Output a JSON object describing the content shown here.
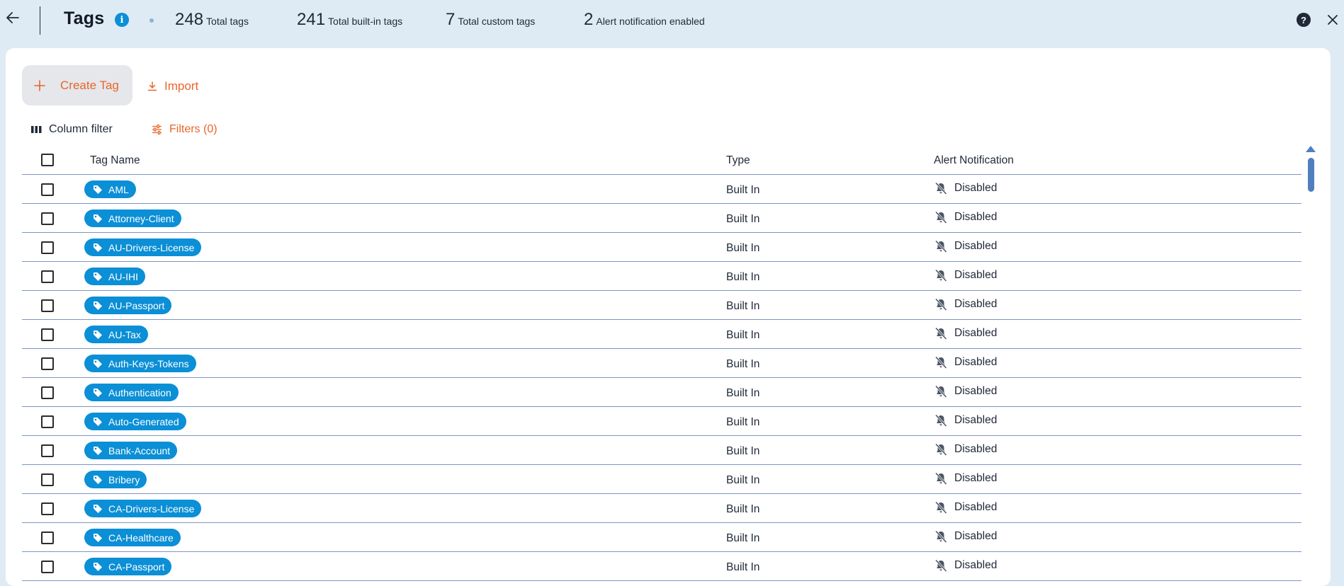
{
  "header": {
    "title": "Tags",
    "stats": [
      {
        "value": "248",
        "label": "Total tags"
      },
      {
        "value": "241",
        "label": "Total built-in tags"
      },
      {
        "value": "7",
        "label": "Total custom tags"
      },
      {
        "value": "2",
        "label": "Alert notification enabled"
      }
    ],
    "icons": [
      "arrow-left-icon",
      "info-icon",
      "help-icon",
      "close-icon"
    ]
  },
  "toolbar": {
    "create_label": "Create Tag",
    "import_label": "Import",
    "column_filter_label": "Column filter",
    "filters_label": "Filters (0)"
  },
  "table": {
    "columns": [
      "Tag Name",
      "Type",
      "Alert Notification"
    ],
    "rows": [
      {
        "tag": "AML",
        "type": "Built In",
        "alert": "Disabled"
      },
      {
        "tag": "Attorney-Client",
        "type": "Built In",
        "alert": "Disabled"
      },
      {
        "tag": "AU-Drivers-License",
        "type": "Built In",
        "alert": "Disabled"
      },
      {
        "tag": "AU-IHI",
        "type": "Built In",
        "alert": "Disabled"
      },
      {
        "tag": "AU-Passport",
        "type": "Built In",
        "alert": "Disabled"
      },
      {
        "tag": "AU-Tax",
        "type": "Built In",
        "alert": "Disabled"
      },
      {
        "tag": "Auth-Keys-Tokens",
        "type": "Built In",
        "alert": "Disabled"
      },
      {
        "tag": "Authentication",
        "type": "Built In",
        "alert": "Disabled"
      },
      {
        "tag": "Auto-Generated",
        "type": "Built In",
        "alert": "Disabled"
      },
      {
        "tag": "Bank-Account",
        "type": "Built In",
        "alert": "Disabled"
      },
      {
        "tag": "Bribery",
        "type": "Built In",
        "alert": "Disabled"
      },
      {
        "tag": "CA-Drivers-License",
        "type": "Built In",
        "alert": "Disabled"
      },
      {
        "tag": "CA-Healthcare",
        "type": "Built In",
        "alert": "Disabled"
      },
      {
        "tag": "CA-Passport",
        "type": "Built In",
        "alert": "Disabled"
      }
    ]
  },
  "colors": {
    "accent": "#e8662b",
    "tag_pill": "#0b8fd6",
    "header_bg": "#dfebf4",
    "row_divider": "#7d96c2"
  }
}
